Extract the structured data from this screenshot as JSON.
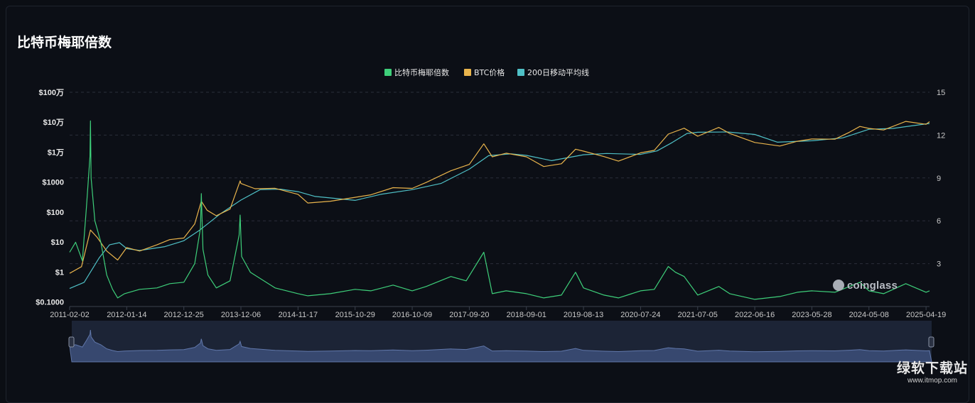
{
  "title": "比特币梅耶倍数",
  "legend": [
    {
      "label": "比特币梅耶倍数",
      "color": "#3ecf7a"
    },
    {
      "label": "BTC价格",
      "color": "#e9b44c"
    },
    {
      "label": "200日移动平均线",
      "color": "#4fc0c6"
    }
  ],
  "watermark": "coinglass",
  "site_watermark": {
    "name": "绿软下载站",
    "url": "www.itmop.com"
  },
  "chart_data": {
    "type": "line",
    "x_dates": [
      "2011-02-02",
      "2012-01-14",
      "2012-12-25",
      "2013-12-06",
      "2014-11-17",
      "2015-10-29",
      "2016-10-09",
      "2017-09-20",
      "2018-09-01",
      "2019-08-13",
      "2020-07-24",
      "2021-07-05",
      "2022-06-16",
      "2023-05-28",
      "2024-05-08",
      "2025-04-19"
    ],
    "xlim": [
      "2011-02-02",
      "2025-05-10"
    ],
    "left_axis": {
      "scale": "log",
      "ticks": [
        0.1,
        1,
        10,
        100,
        1000,
        10000,
        100000,
        1000000
      ],
      "tick_labels": [
        "$0.1000",
        "$1",
        "$10",
        "$100",
        "$1000",
        "$1万",
        "$10万",
        "$100万"
      ],
      "range": [
        0.07,
        1000000
      ]
    },
    "right_axis": {
      "scale": "linear",
      "ticks": [
        3,
        6,
        9,
        12,
        15
      ],
      "tick_labels": [
        "3",
        "6",
        "9",
        "12",
        "15"
      ],
      "range": [
        0,
        15
      ]
    },
    "grid": true,
    "legend_position": "top-center",
    "series": [
      {
        "name": "BTC价格",
        "axis": "left",
        "color": "#e9b44c",
        "points": [
          [
            "2011-02-02",
            0.9
          ],
          [
            "2011-04-15",
            1.5
          ],
          [
            "2011-06-08",
            25
          ],
          [
            "2011-07-20",
            14
          ],
          [
            "2011-09-15",
            5
          ],
          [
            "2011-11-20",
            2.5
          ],
          [
            "2012-01-14",
            6.5
          ],
          [
            "2012-04-01",
            5
          ],
          [
            "2012-07-15",
            8
          ],
          [
            "2012-10-01",
            12
          ],
          [
            "2012-12-25",
            13.5
          ],
          [
            "2013-03-01",
            40
          ],
          [
            "2013-04-10",
            230
          ],
          [
            "2013-05-15",
            115
          ],
          [
            "2013-07-10",
            75
          ],
          [
            "2013-10-01",
            125
          ],
          [
            "2013-12-01",
            1100
          ],
          [
            "2013-12-06",
            900
          ],
          [
            "2014-03-01",
            600
          ],
          [
            "2014-07-01",
            620
          ],
          [
            "2014-11-17",
            390
          ],
          [
            "2015-01-15",
            200
          ],
          [
            "2015-06-01",
            230
          ],
          [
            "2015-10-29",
            310
          ],
          [
            "2016-02-01",
            375
          ],
          [
            "2016-06-15",
            650
          ],
          [
            "2016-10-09",
            615
          ],
          [
            "2017-01-01",
            970
          ],
          [
            "2017-06-01",
            2400
          ],
          [
            "2017-09-20",
            3900
          ],
          [
            "2017-12-17",
            19000
          ],
          [
            "2018-02-06",
            7000
          ],
          [
            "2018-05-01",
            9200
          ],
          [
            "2018-09-01",
            7000
          ],
          [
            "2018-12-15",
            3300
          ],
          [
            "2019-04-01",
            4100
          ],
          [
            "2019-06-26",
            12500
          ],
          [
            "2019-08-13",
            10800
          ],
          [
            "2019-12-15",
            7100
          ],
          [
            "2020-03-12",
            5000
          ],
          [
            "2020-07-24",
            9500
          ],
          [
            "2020-10-15",
            11500
          ],
          [
            "2021-01-08",
            40000
          ],
          [
            "2021-04-14",
            63000
          ],
          [
            "2021-07-05",
            34000
          ],
          [
            "2021-11-10",
            67000
          ],
          [
            "2022-01-15",
            42000
          ],
          [
            "2022-06-16",
            21000
          ],
          [
            "2022-11-15",
            16000
          ],
          [
            "2023-03-01",
            23000
          ],
          [
            "2023-05-28",
            27500
          ],
          [
            "2023-10-15",
            27000
          ],
          [
            "2024-01-10",
            46000
          ],
          [
            "2024-03-14",
            72000
          ],
          [
            "2024-05-08",
            62000
          ],
          [
            "2024-08-05",
            55000
          ],
          [
            "2024-12-17",
            106000
          ],
          [
            "2025-04-19",
            85000
          ],
          [
            "2025-05-10",
            104000
          ]
        ]
      },
      {
        "name": "200日移动平均线",
        "axis": "left",
        "color": "#4fc0c6",
        "points": [
          [
            "2011-02-02",
            0.28
          ],
          [
            "2011-05-01",
            0.45
          ],
          [
            "2011-08-01",
            3
          ],
          [
            "2011-10-01",
            8
          ],
          [
            "2011-12-01",
            9.5
          ],
          [
            "2012-01-14",
            6
          ],
          [
            "2012-04-01",
            5.2
          ],
          [
            "2012-09-01",
            7
          ],
          [
            "2012-12-25",
            11
          ],
          [
            "2013-04-01",
            25
          ],
          [
            "2013-08-01",
            85
          ],
          [
            "2013-12-06",
            250
          ],
          [
            "2014-04-01",
            560
          ],
          [
            "2014-08-01",
            580
          ],
          [
            "2014-11-17",
            480
          ],
          [
            "2015-03-01",
            330
          ],
          [
            "2015-10-29",
            245
          ],
          [
            "2016-04-01",
            390
          ],
          [
            "2016-10-09",
            560
          ],
          [
            "2017-04-01",
            900
          ],
          [
            "2017-09-20",
            2700
          ],
          [
            "2018-01-15",
            7600
          ],
          [
            "2018-06-01",
            8800
          ],
          [
            "2018-09-01",
            7800
          ],
          [
            "2019-02-01",
            5200
          ],
          [
            "2019-08-13",
            8200
          ],
          [
            "2020-01-01",
            9000
          ],
          [
            "2020-07-24",
            8400
          ],
          [
            "2020-11-01",
            11000
          ],
          [
            "2021-02-01",
            21000
          ],
          [
            "2021-05-01",
            42000
          ],
          [
            "2021-07-05",
            46000
          ],
          [
            "2022-01-01",
            47000
          ],
          [
            "2022-06-16",
            39000
          ],
          [
            "2022-11-01",
            21500
          ],
          [
            "2023-05-28",
            24000
          ],
          [
            "2023-12-01",
            30000
          ],
          [
            "2024-05-08",
            58000
          ],
          [
            "2024-10-01",
            62000
          ],
          [
            "2025-04-19",
            88000
          ],
          [
            "2025-05-10",
            90000
          ]
        ]
      },
      {
        "name": "比特币梅耶倍数",
        "axis": "right",
        "color": "#3ecf7a",
        "points": [
          [
            "2011-02-02",
            3.8
          ],
          [
            "2011-03-10",
            4.5
          ],
          [
            "2011-04-20",
            3.2
          ],
          [
            "2011-05-15",
            7
          ],
          [
            "2011-06-05",
            10.5
          ],
          [
            "2011-06-08",
            13
          ],
          [
            "2011-06-12",
            9
          ],
          [
            "2011-07-05",
            6
          ],
          [
            "2011-08-10",
            4.5
          ],
          [
            "2011-09-15",
            2.2
          ],
          [
            "2011-10-20",
            1.2
          ],
          [
            "2011-11-20",
            0.6
          ],
          [
            "2012-01-01",
            0.9
          ],
          [
            "2012-04-01",
            1.2
          ],
          [
            "2012-07-15",
            1.3
          ],
          [
            "2012-10-01",
            1.6
          ],
          [
            "2012-12-25",
            1.7
          ],
          [
            "2013-03-01",
            3
          ],
          [
            "2013-04-05",
            5.5
          ],
          [
            "2013-04-10",
            7.9
          ],
          [
            "2013-04-20",
            4
          ],
          [
            "2013-05-20",
            2.2
          ],
          [
            "2013-07-10",
            1.3
          ],
          [
            "2013-10-01",
            1.8
          ],
          [
            "2013-11-25",
            5
          ],
          [
            "2013-12-01",
            6.4
          ],
          [
            "2013-12-10",
            3.5
          ],
          [
            "2014-02-01",
            2.4
          ],
          [
            "2014-07-01",
            1.3
          ],
          [
            "2014-11-17",
            0.9
          ],
          [
            "2015-01-15",
            0.75
          ],
          [
            "2015-06-01",
            0.9
          ],
          [
            "2015-10-29",
            1.2
          ],
          [
            "2016-02-01",
            1.1
          ],
          [
            "2016-06-15",
            1.5
          ],
          [
            "2016-10-09",
            1.1
          ],
          [
            "2017-01-01",
            1.4
          ],
          [
            "2017-06-01",
            2.1
          ],
          [
            "2017-09-01",
            1.8
          ],
          [
            "2017-12-17",
            3.8
          ],
          [
            "2018-02-06",
            0.9
          ],
          [
            "2018-05-01",
            1.1
          ],
          [
            "2018-09-01",
            0.9
          ],
          [
            "2018-12-15",
            0.6
          ],
          [
            "2019-04-01",
            0.8
          ],
          [
            "2019-06-26",
            2.4
          ],
          [
            "2019-08-13",
            1.3
          ],
          [
            "2019-12-15",
            0.8
          ],
          [
            "2020-03-12",
            0.6
          ],
          [
            "2020-07-24",
            1.1
          ],
          [
            "2020-10-15",
            1.2
          ],
          [
            "2021-01-08",
            2.8
          ],
          [
            "2021-02-20",
            2.4
          ],
          [
            "2021-04-14",
            2.1
          ],
          [
            "2021-07-05",
            0.8
          ],
          [
            "2021-11-10",
            1.4
          ],
          [
            "2022-01-15",
            0.9
          ],
          [
            "2022-06-16",
            0.5
          ],
          [
            "2022-11-15",
            0.7
          ],
          [
            "2023-03-01",
            1
          ],
          [
            "2023-05-28",
            1.1
          ],
          [
            "2023-10-15",
            1
          ],
          [
            "2024-01-10",
            1.4
          ],
          [
            "2024-03-14",
            1.7
          ],
          [
            "2024-05-08",
            1.1
          ],
          [
            "2024-08-05",
            0.9
          ],
          [
            "2024-12-17",
            1.6
          ],
          [
            "2025-04-19",
            1
          ],
          [
            "2025-05-10",
            1.1
          ]
        ]
      }
    ]
  }
}
